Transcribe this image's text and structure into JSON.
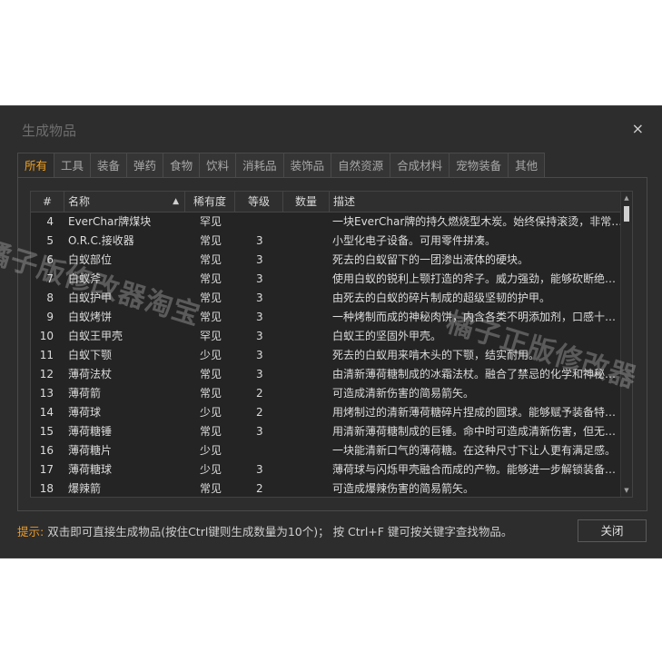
{
  "dialog": {
    "title": "生成物品",
    "close_symbol": "×"
  },
  "tabs": [
    {
      "label": "所有",
      "active": true
    },
    {
      "label": "工具"
    },
    {
      "label": "装备"
    },
    {
      "label": "弹药"
    },
    {
      "label": "食物"
    },
    {
      "label": "饮料"
    },
    {
      "label": "消耗品"
    },
    {
      "label": "装饰品"
    },
    {
      "label": "自然资源"
    },
    {
      "label": "合成材料"
    },
    {
      "label": "宠物装备"
    },
    {
      "label": "其他"
    }
  ],
  "table": {
    "headers": {
      "num": "#",
      "name": "名称",
      "rarity": "稀有度",
      "level": "等级",
      "qty": "数量",
      "desc": "描述"
    },
    "sort_icon": "sort-ascending-icon",
    "rows": [
      {
        "num": "4",
        "name": "EverChar牌煤块",
        "rarity": "罕见",
        "level": "",
        "qty": "",
        "desc": "一块EverChar牌的持久燃烧型木炭。始终保持滚烫，非常…"
      },
      {
        "num": "5",
        "name": "O.R.C.接收器",
        "rarity": "常见",
        "level": "3",
        "qty": "",
        "desc": "小型化电子设备。可用零件拼凑。"
      },
      {
        "num": "6",
        "name": "白蚁部位",
        "rarity": "常见",
        "level": "3",
        "qty": "",
        "desc": "死去的白蚁留下的一团渗出液体的硬块。"
      },
      {
        "num": "7",
        "name": "白蚁斧",
        "rarity": "常见",
        "level": "3",
        "qty": "",
        "desc": "使用白蚁的锐利上颚打造的斧子。威力强劲，能够砍断绝…"
      },
      {
        "num": "8",
        "name": "白蚁护甲",
        "rarity": "常见",
        "level": "3",
        "qty": "",
        "desc": "由死去的白蚁的碎片制成的超级坚韧的护甲。"
      },
      {
        "num": "9",
        "name": "白蚁烤饼",
        "rarity": "常见",
        "level": "3",
        "qty": "",
        "desc": "一种烤制而成的神秘肉饼，内含各类不明添加剂，口感十…"
      },
      {
        "num": "10",
        "name": "白蚁王甲壳",
        "rarity": "罕见",
        "level": "3",
        "qty": "",
        "desc": "白蚁王的坚固外甲壳。"
      },
      {
        "num": "11",
        "name": "白蚁下颚",
        "rarity": "少见",
        "level": "3",
        "qty": "",
        "desc": "死去的白蚁用来啃木头的下颚，结实耐用。"
      },
      {
        "num": "12",
        "name": "薄荷法杖",
        "rarity": "常见",
        "level": "3",
        "qty": "",
        "desc": "由清新薄荷糖制成的冰霜法杖。融合了禁忌的化学和神秘…"
      },
      {
        "num": "13",
        "name": "薄荷箭",
        "rarity": "常见",
        "level": "2",
        "qty": "",
        "desc": "可造成清新伤害的简易箭矢。"
      },
      {
        "num": "14",
        "name": "薄荷球",
        "rarity": "少见",
        "level": "2",
        "qty": "",
        "desc": "用烤制过的清新薄荷糖碎片捏成的圆球。能够赋予装备特…"
      },
      {
        "num": "15",
        "name": "薄荷糖锤",
        "rarity": "常见",
        "level": "3",
        "qty": "",
        "desc": "用清新薄荷糖制成的巨锤。命中时可造成清新伤害，但无…"
      },
      {
        "num": "16",
        "name": "薄荷糖片",
        "rarity": "少见",
        "level": "",
        "qty": "",
        "desc": "一块能清新口气的薄荷糖。在这种尺寸下让人更有满足感。"
      },
      {
        "num": "17",
        "name": "薄荷糖球",
        "rarity": "少见",
        "level": "3",
        "qty": "",
        "desc": "薄荷球与闪烁甲壳融合而成的产物。能够进一步解锁装备…"
      },
      {
        "num": "18",
        "name": "爆辣箭",
        "rarity": "常见",
        "level": "2",
        "qty": "",
        "desc": "可造成爆辣伤害的简易箭矢。"
      }
    ]
  },
  "footer": {
    "tip_label": "提示:",
    "tip_text": "双击即可直接生成物品(按住Ctrl键则生成数量为10个)； 按 Ctrl+F 键可按关键字查找物品。",
    "close_button": "关闭"
  },
  "watermarks": {
    "left": "橘子版修改器淘宝",
    "right": "橘子正版修改器"
  }
}
